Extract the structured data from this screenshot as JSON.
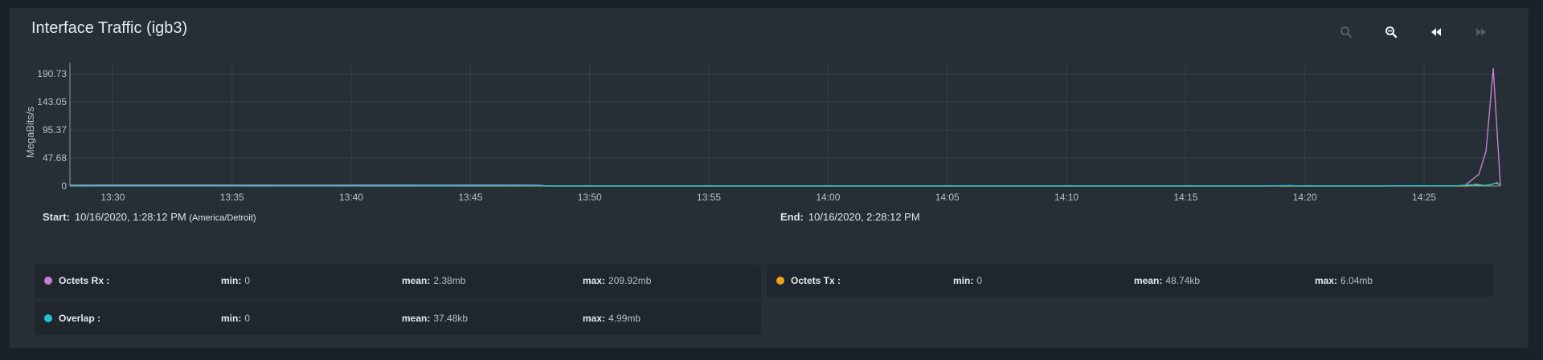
{
  "panel": {
    "title": "Interface Traffic (igb3)"
  },
  "toolbar": {
    "icons": [
      "zoom-in-icon",
      "zoom-out-icon",
      "step-back-icon",
      "step-forward-icon"
    ]
  },
  "range": {
    "start_label": "Start:",
    "start_value": "10/16/2020, 1:28:12 PM",
    "start_tz": "(America/Detroit)",
    "end_label": "End:",
    "end_value": "10/16/2020, 2:28:12 PM"
  },
  "colors": {
    "rx": "#c97fd0",
    "tx": "#f0a11a",
    "overlap": "#20c4cf",
    "grid": "#36404a",
    "axis": "#8d969f"
  },
  "legend": {
    "rx": {
      "name": "Octets Rx :",
      "min_label": "min:",
      "min": "0",
      "mean_label": "mean:",
      "mean": "2.38mb",
      "max_label": "max:",
      "max": "209.92mb"
    },
    "tx": {
      "name": "Octets Tx :",
      "min_label": "min:",
      "min": "0",
      "mean_label": "mean:",
      "mean": "48.74kb",
      "max_label": "max:",
      "max": "6.04mb"
    },
    "overlap": {
      "name": "Overlap :",
      "min_label": "min:",
      "min": "0",
      "mean_label": "mean:",
      "mean": "37.48kb",
      "max_label": "max:",
      "max": "4.99mb"
    }
  },
  "chart_data": {
    "type": "line",
    "ylabel": "MegaBits/s",
    "ylim": [
      0,
      209.92
    ],
    "yticks": [
      0,
      47.68,
      95.37,
      143.05,
      190.73
    ],
    "ytick_labels": [
      "0",
      "47.68",
      "95.37",
      "143.05",
      "190.73"
    ],
    "xlim": [
      0,
      60
    ],
    "xticks": [
      1.8,
      6.8,
      11.8,
      16.8,
      21.8,
      26.8,
      31.8,
      36.8,
      41.8,
      46.8,
      51.8,
      56.8
    ],
    "xtick_labels": [
      "13:30",
      "13:35",
      "13:40",
      "13:45",
      "13:50",
      "13:55",
      "14:00",
      "14:05",
      "14:10",
      "14:15",
      "14:20",
      "14:25"
    ],
    "grid": true,
    "series": [
      {
        "name": "Octets Rx",
        "color_key": "rx",
        "x": [
          0,
          5,
          10,
          13,
          15,
          18,
          19.7,
          20,
          22,
          25,
          30,
          35,
          40,
          45,
          50,
          55,
          58.5,
          59.1,
          59.4,
          59.7,
          60
        ],
        "y": [
          1.5,
          1.6,
          1.5,
          1.6,
          1.5,
          1.6,
          1.2,
          0.1,
          0.1,
          0.1,
          0.1,
          0.1,
          0.1,
          0.1,
          0.1,
          0.2,
          0.5,
          20,
          60,
          200,
          0.5
        ]
      },
      {
        "name": "Octets Tx",
        "color_key": "tx",
        "x": [
          0,
          10,
          20,
          30,
          40,
          50,
          55,
          58.6,
          59.0,
          59.3,
          59.6,
          59.85,
          60
        ],
        "y": [
          0.2,
          0.2,
          0.1,
          0.1,
          0.1,
          0.1,
          0.1,
          0.2,
          3,
          1,
          2,
          6,
          1
        ]
      },
      {
        "name": "Overlap",
        "color_key": "overlap",
        "x": [
          0,
          10,
          19.6,
          20,
          25,
          30,
          35,
          40,
          50,
          51.2,
          51.5,
          55,
          56.8,
          58,
          58.8,
          59.1,
          59.5,
          59.8,
          60
        ],
        "y": [
          0.3,
          0.3,
          0.4,
          0.1,
          0.1,
          0.1,
          0.1,
          0.1,
          0.1,
          0.8,
          0.1,
          0.1,
          0.5,
          0.2,
          2,
          0.5,
          1.5,
          4.99,
          2
        ]
      }
    ]
  }
}
